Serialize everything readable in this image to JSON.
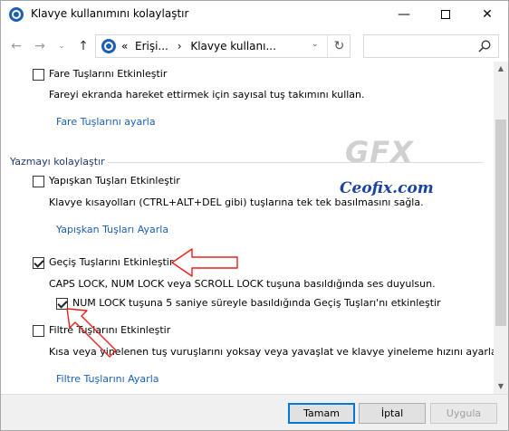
{
  "window": {
    "title": "Klavye kullanımını kolaylaştır",
    "minimize": "—",
    "close": "✕"
  },
  "nav": {
    "back": "←",
    "forward": "→",
    "recent": "⌄",
    "up": "↑",
    "address_prefix": "«",
    "breadcrumb_1": "Erişi...",
    "breadcrumb_sep": "›",
    "breadcrumb_2": "Klavye kullanı...",
    "dropdown": "⌄",
    "refresh": "↻",
    "search_placeholder": ""
  },
  "mouse_keys": {
    "checkbox_label": "Fare Tuşlarını Etkinleştir",
    "checked": false,
    "description": "Fareyi ekranda hareket ettirmek için sayısal tuş takımını kullan.",
    "link": "Fare Tuşlarını ayarla"
  },
  "section": {
    "title": "Yazmayı kolaylaştır"
  },
  "sticky_keys": {
    "checkbox_label": "Yapışkan Tuşları Etkinleştir",
    "checked": false,
    "description": "Klavye kısayolları (CTRL+ALT+DEL gibi) tuşlarına tek tek basılmasını sağla.",
    "link": "Yapışkan Tuşları Ayarla"
  },
  "toggle_keys": {
    "checkbox_label": "Geçiş Tuşlarını Etkinleştir",
    "checked": true,
    "description": "CAPS LOCK, NUM LOCK veya SCROLL LOCK tuşuna basıldığında ses duyulsun.",
    "sub_checkbox_label": "NUM LOCK tuşuna 5 saniye süreyle basıldığında Geçiş Tuşları'nı etkinleştir",
    "sub_checked": true
  },
  "filter_keys": {
    "checkbox_label": "Filtre Tuşlarını Etkinleştir",
    "checked": false,
    "description": "Kısa veya yinelenen tuş vuruşlarını yoksay veya yavaşlat ve klavye yineleme hızını ayarla.",
    "link": "Filtre Tuşlarını Ayarla"
  },
  "watermark": {
    "logo": "GFX",
    "site": "Ceofix.com"
  },
  "footer": {
    "ok": "Tamam",
    "cancel": "İptal",
    "apply": "Uygula"
  },
  "colors": {
    "link": "#1a5fb4",
    "section_title": "#1e3a6e",
    "annotation_arrow": "#e8201c",
    "accent": "#0078d7"
  }
}
